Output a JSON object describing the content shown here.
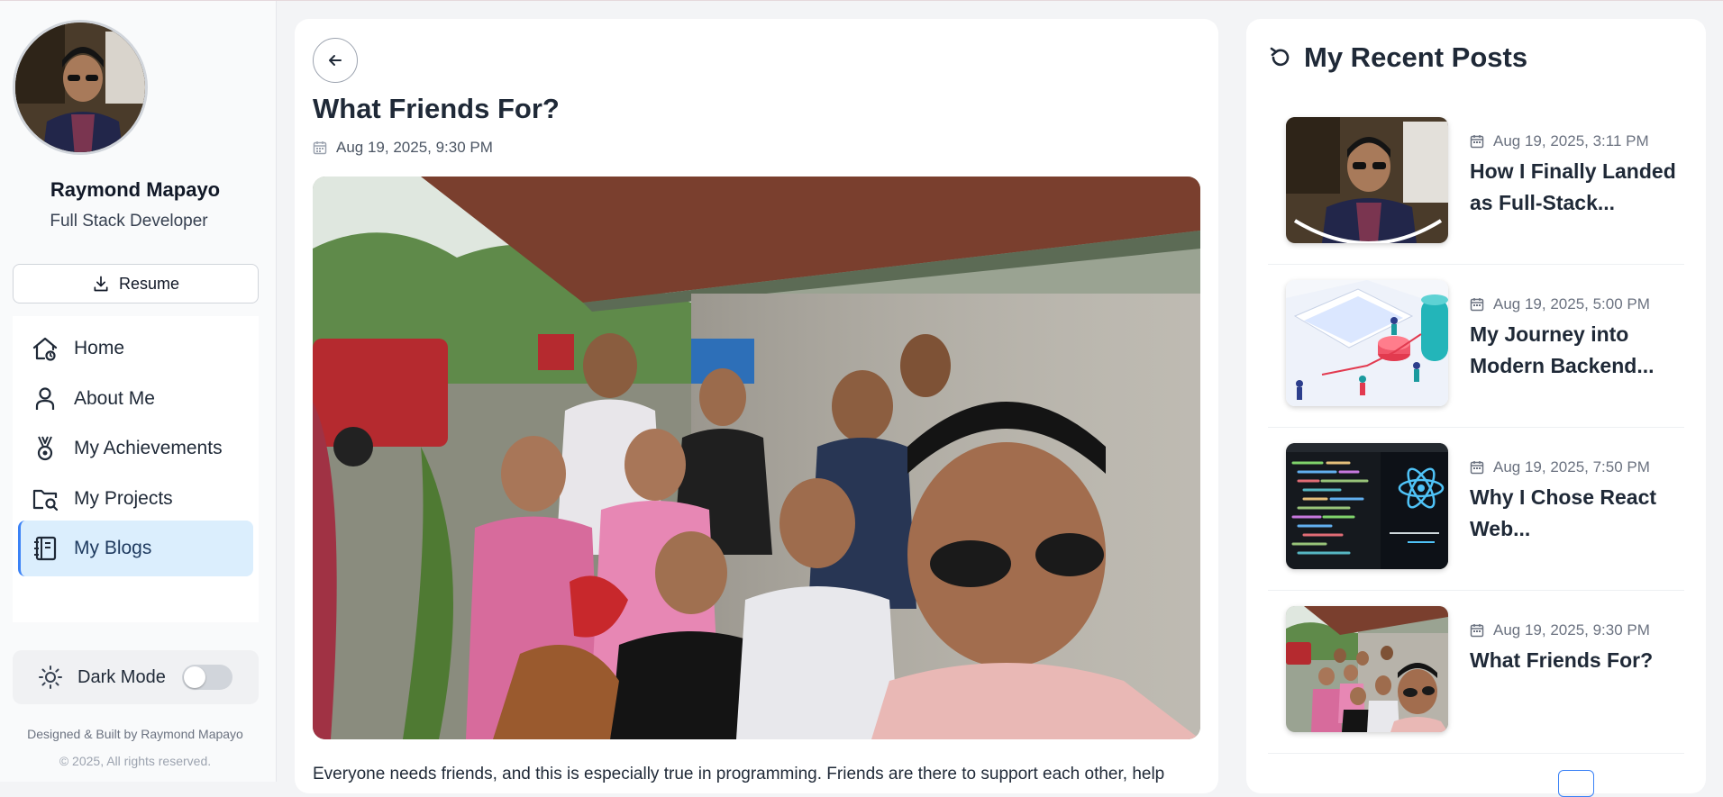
{
  "profile": {
    "name": "Raymond Mapayo",
    "role": "Full Stack Developer",
    "avatar_icon": "profile-photo"
  },
  "sidebar": {
    "resume_label": "Resume",
    "items": [
      {
        "label": "Home",
        "icon": "home-icon",
        "active": false
      },
      {
        "label": "About Me",
        "icon": "user-icon",
        "active": false
      },
      {
        "label": "My Achievements",
        "icon": "medal-icon",
        "active": false
      },
      {
        "label": "My Projects",
        "icon": "folder-search-icon",
        "active": false
      },
      {
        "label": "My Blogs",
        "icon": "notebook-icon",
        "active": true
      }
    ],
    "dark_mode_label": "Dark Mode",
    "dark_mode_on": false,
    "footer_credit": "Designed & Built by Raymond Mapayo",
    "footer_copyright": "© 2025, All rights reserved."
  },
  "article": {
    "title": "What Friends For?",
    "date": "Aug 19, 2025, 9:30 PM",
    "body": "Everyone needs friends, and this is especially true in programming. Friends are there to support each other, help"
  },
  "recent": {
    "heading": "My Recent Posts",
    "posts": [
      {
        "date": "Aug 19, 2025, 3:11 PM",
        "title": "How I Finally Landed as Full-Stack..."
      },
      {
        "date": "Aug 19, 2025, 5:00 PM",
        "title": "My Journey into Modern Backend..."
      },
      {
        "date": "Aug 19, 2025, 7:50 PM",
        "title": "Why I Chose React Web..."
      },
      {
        "date": "Aug 19, 2025, 9:30 PM",
        "title": "What Friends For?"
      }
    ]
  },
  "colors": {
    "accent": "#3b82f6",
    "active_bg": "#dbeefd",
    "text": "#1f2937"
  }
}
